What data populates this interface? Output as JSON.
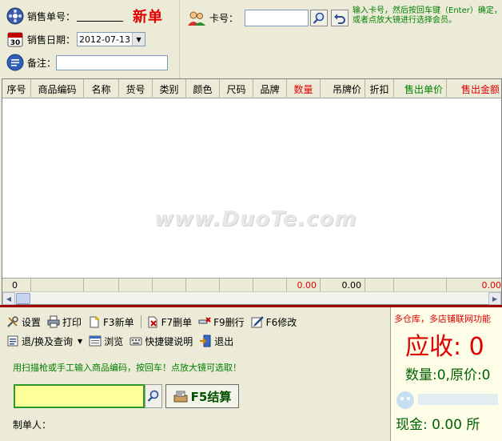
{
  "header": {
    "sale_no_label": "销售单号：",
    "new_bill_label": "新单",
    "sale_date_label": "销售日期：",
    "sale_date_value": "2012-07-13",
    "remark_label": "备注：",
    "card_label": "卡号：",
    "card_hint": "输入卡号，然后按回车键（Enter）确定，或者点放大镜进行选择会员。"
  },
  "table": {
    "columns": [
      "序号",
      "商品编码",
      "名称",
      "货号",
      "类别",
      "颜色",
      "尺码",
      "品牌",
      "数量",
      "吊牌价",
      "折扣",
      "售出单价",
      "售出金额"
    ],
    "footer": [
      "0",
      "",
      "",
      "",
      "",
      "",
      "",
      "",
      "0.00",
      "0.00",
      "",
      "",
      "0.00"
    ]
  },
  "watermark": "www.DuoTe.com",
  "toolbar": {
    "settings": "设置",
    "print": "打印",
    "new": "F3新单",
    "delete_bill": "F7删单",
    "delete_row": "F9删行",
    "modify": "F6修改",
    "return": "退/换及查询",
    "browse": "浏览",
    "shortcuts": "快捷键说明",
    "exit": "退出"
  },
  "scan": {
    "hint": "用扫描枪或手工输入商品编码，按回车！点放大镜可选取！",
    "settle_label": "F5结算",
    "maker_label": "制单人："
  },
  "summary": {
    "title": "多仓库，多店铺联网功能",
    "receivable": "应收:  0",
    "qty_price": "数量:0,原价:0",
    "cash": "现金: 0.00  所"
  },
  "colors": {
    "accent_red": "#e00000",
    "accent_green": "#008000",
    "panel_bg": "#ecebd8"
  }
}
